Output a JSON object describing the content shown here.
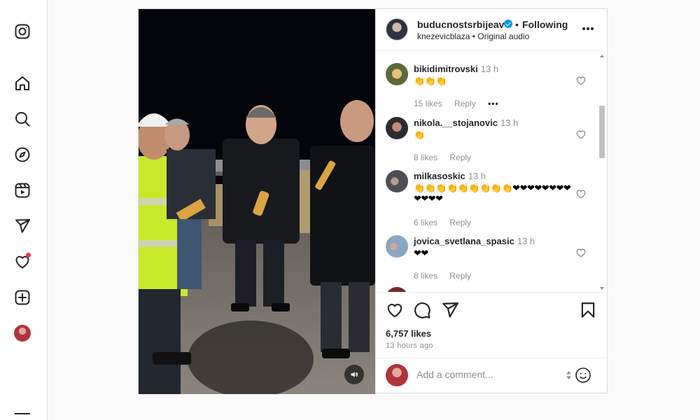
{
  "sidebar": {
    "items": [
      {
        "name": "instagram-icon"
      },
      {
        "name": "home-icon"
      },
      {
        "name": "search-icon"
      },
      {
        "name": "explore-icon"
      },
      {
        "name": "reels-icon"
      },
      {
        "name": "messages-icon"
      },
      {
        "name": "notifications-icon"
      },
      {
        "name": "create-icon"
      }
    ],
    "notification_color": "#ff3040"
  },
  "post": {
    "header": {
      "username": "buducnostsrbijeav",
      "verified_color": "#0095f6",
      "separator": "•",
      "follow_label": "Following",
      "subtitle": "knezevicblaza • Original audio"
    },
    "comments": [
      {
        "username": "bikidimitrovski",
        "time": "13 h",
        "text": "👏👏👏",
        "likes": "15 likes",
        "reply": "Reply",
        "more": "•••"
      },
      {
        "username": "nikola.__stojanovic",
        "time": "13 h",
        "text": "👏",
        "likes": "8 likes",
        "reply": "Reply"
      },
      {
        "username": "milkasoskic",
        "time": "13 h",
        "text": "👏👏👏👏👏👏👏👏👏❤❤❤❤❤❤❤❤❤❤❤❤",
        "likes": "6 likes",
        "reply": "Reply"
      },
      {
        "username": "jovica_svetlana_spasic",
        "time": "13 h",
        "text": "❤❤",
        "likes": "8 likes",
        "reply": "Reply"
      },
      {
        "username": "",
        "time": "",
        "text": ""
      }
    ],
    "likes_count": "6,757 likes",
    "time_ago": "13 hours ago",
    "comment_placeholder": "Add a comment..."
  }
}
